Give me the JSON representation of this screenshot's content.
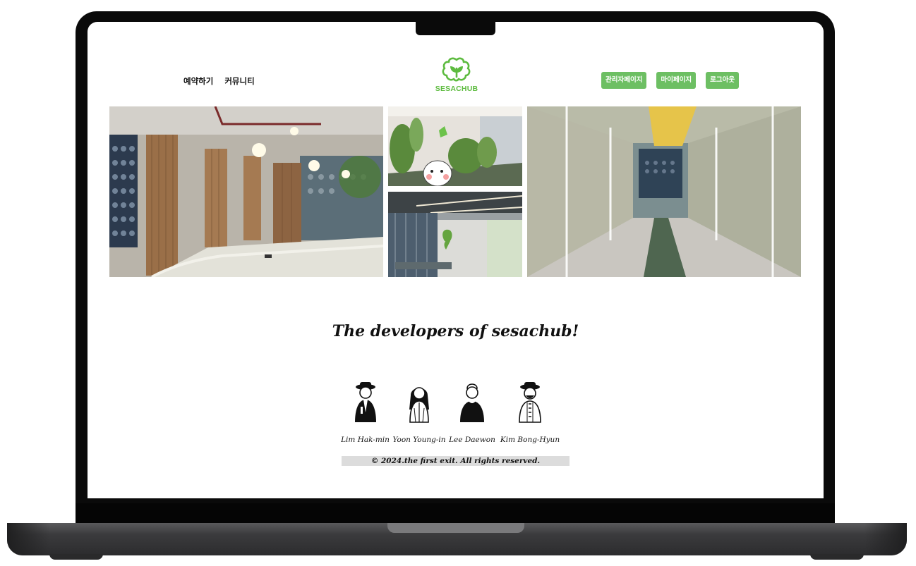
{
  "nav": {
    "left_links": [
      "예약하기",
      "커뮤니티"
    ],
    "logo_text": "SESACHUB",
    "right_buttons": [
      "관리자페이지",
      "마이페이지",
      "로그아웃"
    ]
  },
  "gallery": {
    "photos": [
      "lounge-interior-photo",
      "wall-plants-sign-photo",
      "entrance-sign-photo",
      "corridor-photo"
    ]
  },
  "developers": {
    "title": "The developers of sesachub!",
    "members": [
      {
        "name": "Lim Hak-min",
        "icon": "hat-man-avatar-icon"
      },
      {
        "name": "Yoon Young-in",
        "icon": "long-hair-woman-avatar-icon"
      },
      {
        "name": "Lee Daewon",
        "icon": "short-hair-man-avatar-icon"
      },
      {
        "name": "Kim Bong-Hyun",
        "icon": "hat-beard-man-avatar-icon"
      }
    ]
  },
  "footer": {
    "copyright": "© 2024.the first exit. All rights reserved."
  },
  "colors": {
    "brand_green": "#5dbb3f",
    "button_green": "#6dbf63",
    "footer_bar": "#dcdcdc"
  }
}
